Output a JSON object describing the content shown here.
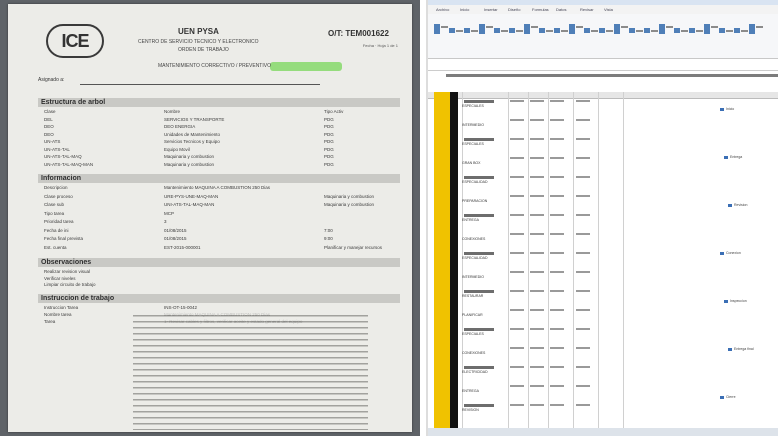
{
  "document": {
    "logo": "ICE",
    "header_title": "UEN PYSA",
    "header_subtitle": "CENTRO DE SERVICIO TECNICO Y ELECTRONICO",
    "header_subtitle2": "ORDEN DE TRABAJO",
    "ot_label": "O/T: TEM001622",
    "ot_meta": "Fecha · Hoja 1 de 1",
    "maintenance_line": "MANTENIMIENTO CORRECTIVO / PREVENTIVO",
    "assigned_label": "Asignado a:",
    "sections": {
      "estructura": "Estructura de arbol",
      "informacion": "Informacion",
      "observaciones": "Observaciones",
      "instrucciones": "Instruccion de trabajo"
    },
    "tree_rows": [
      {
        "a": "Clase",
        "b": "Nombre",
        "c": "Tipo Activ"
      },
      {
        "a": "DEL",
        "b": "SERVICIOS Y TRANSPORTE",
        "c": "PDG"
      },
      {
        "a": "DEO",
        "b": "DEO ENERGIA",
        "c": "PDG"
      },
      {
        "a": "DEO",
        "b": "Unidades de Mantenimiento",
        "c": "PDG"
      },
      {
        "a": "UN-ATS",
        "b": "Servicios Tecnicos y Equipo",
        "c": "PDG"
      },
      {
        "a": "UN-ATS-TAL",
        "b": "Equipo Movil",
        "c": "PDG"
      },
      {
        "a": "UN-ATS-TAL-MAQ",
        "b": "Maquinaria y combustion",
        "c": "PDG"
      },
      {
        "a": "UN-ATS-TAL-MAQ-MAN",
        "b": "Maquinaria y combustion",
        "c": "PDG"
      }
    ],
    "info_rows": [
      {
        "a": "Descripcion",
        "b": "Mantenimiento MAQUINA A COMBUSTION 250 Dias",
        "c": ""
      },
      {
        "a": "Clase proceso",
        "b": "URE-PYS-UNE-MAQ-MAN",
        "c": "Maquinaria y combustion"
      },
      {
        "a": "Clase sub",
        "b": "UNI-ATS-TAL-MAQ-MAN",
        "c": "Maquinaria y combustion"
      },
      {
        "a": "Tipo tarea",
        "b": "MCP",
        "c": ""
      },
      {
        "a": "Prioridad tarea",
        "b": "3",
        "c": ""
      },
      {
        "a": "Fecha de ini",
        "b": "01/08/2015",
        "c": "7:00"
      },
      {
        "a": "Fecha final prevista",
        "b": "01/08/2015",
        "c": "9:00"
      },
      {
        "a": "Est. cuenta",
        "b": "EST-2015-000001",
        "c": "Planificar y manejar recursos"
      }
    ],
    "observ_rows": [
      "Realizar revision visual",
      "Verificar niveles",
      "Limpiar circuito de trabajo"
    ],
    "instr_rows": [
      {
        "a": "Instruccion Tarea",
        "b": "INS-OT-15-0042"
      },
      {
        "a": "Nombre tarea",
        "b": "Mantenimiento MAQUINA A COMBUSTION 250 Dias"
      },
      {
        "a": "Tarea",
        "b": "1- Revisar cables y filtros, verificar aceite y estado general del equipo"
      }
    ]
  },
  "spreadsheet": {
    "tabs": [
      "Archivo",
      "Inicio",
      "Insertar",
      "Diseño",
      "Formulas",
      "Datos",
      "Revisar",
      "Vista"
    ],
    "wbs_rows": [
      "ESPECIALES",
      "INTERMEDIO",
      "ESPECIALES",
      "GRAN BOX",
      "ESPECIALIDAD",
      "PREPARACION",
      "ENTREGA",
      "CONEXIONES",
      "ESPECIALIDAD",
      "INTERMEDIO",
      "RESTAURAR",
      "PLANIFICAR",
      "ESPECIALES",
      "CONEXIONES",
      "ELECTRICIDAD",
      "ENTREGA",
      "REVISION"
    ],
    "task_labels": [
      "Inicio",
      "Entrega",
      "Revision",
      "Conexion",
      "Inspeccion",
      "Entrega final",
      "Cierre"
    ]
  }
}
